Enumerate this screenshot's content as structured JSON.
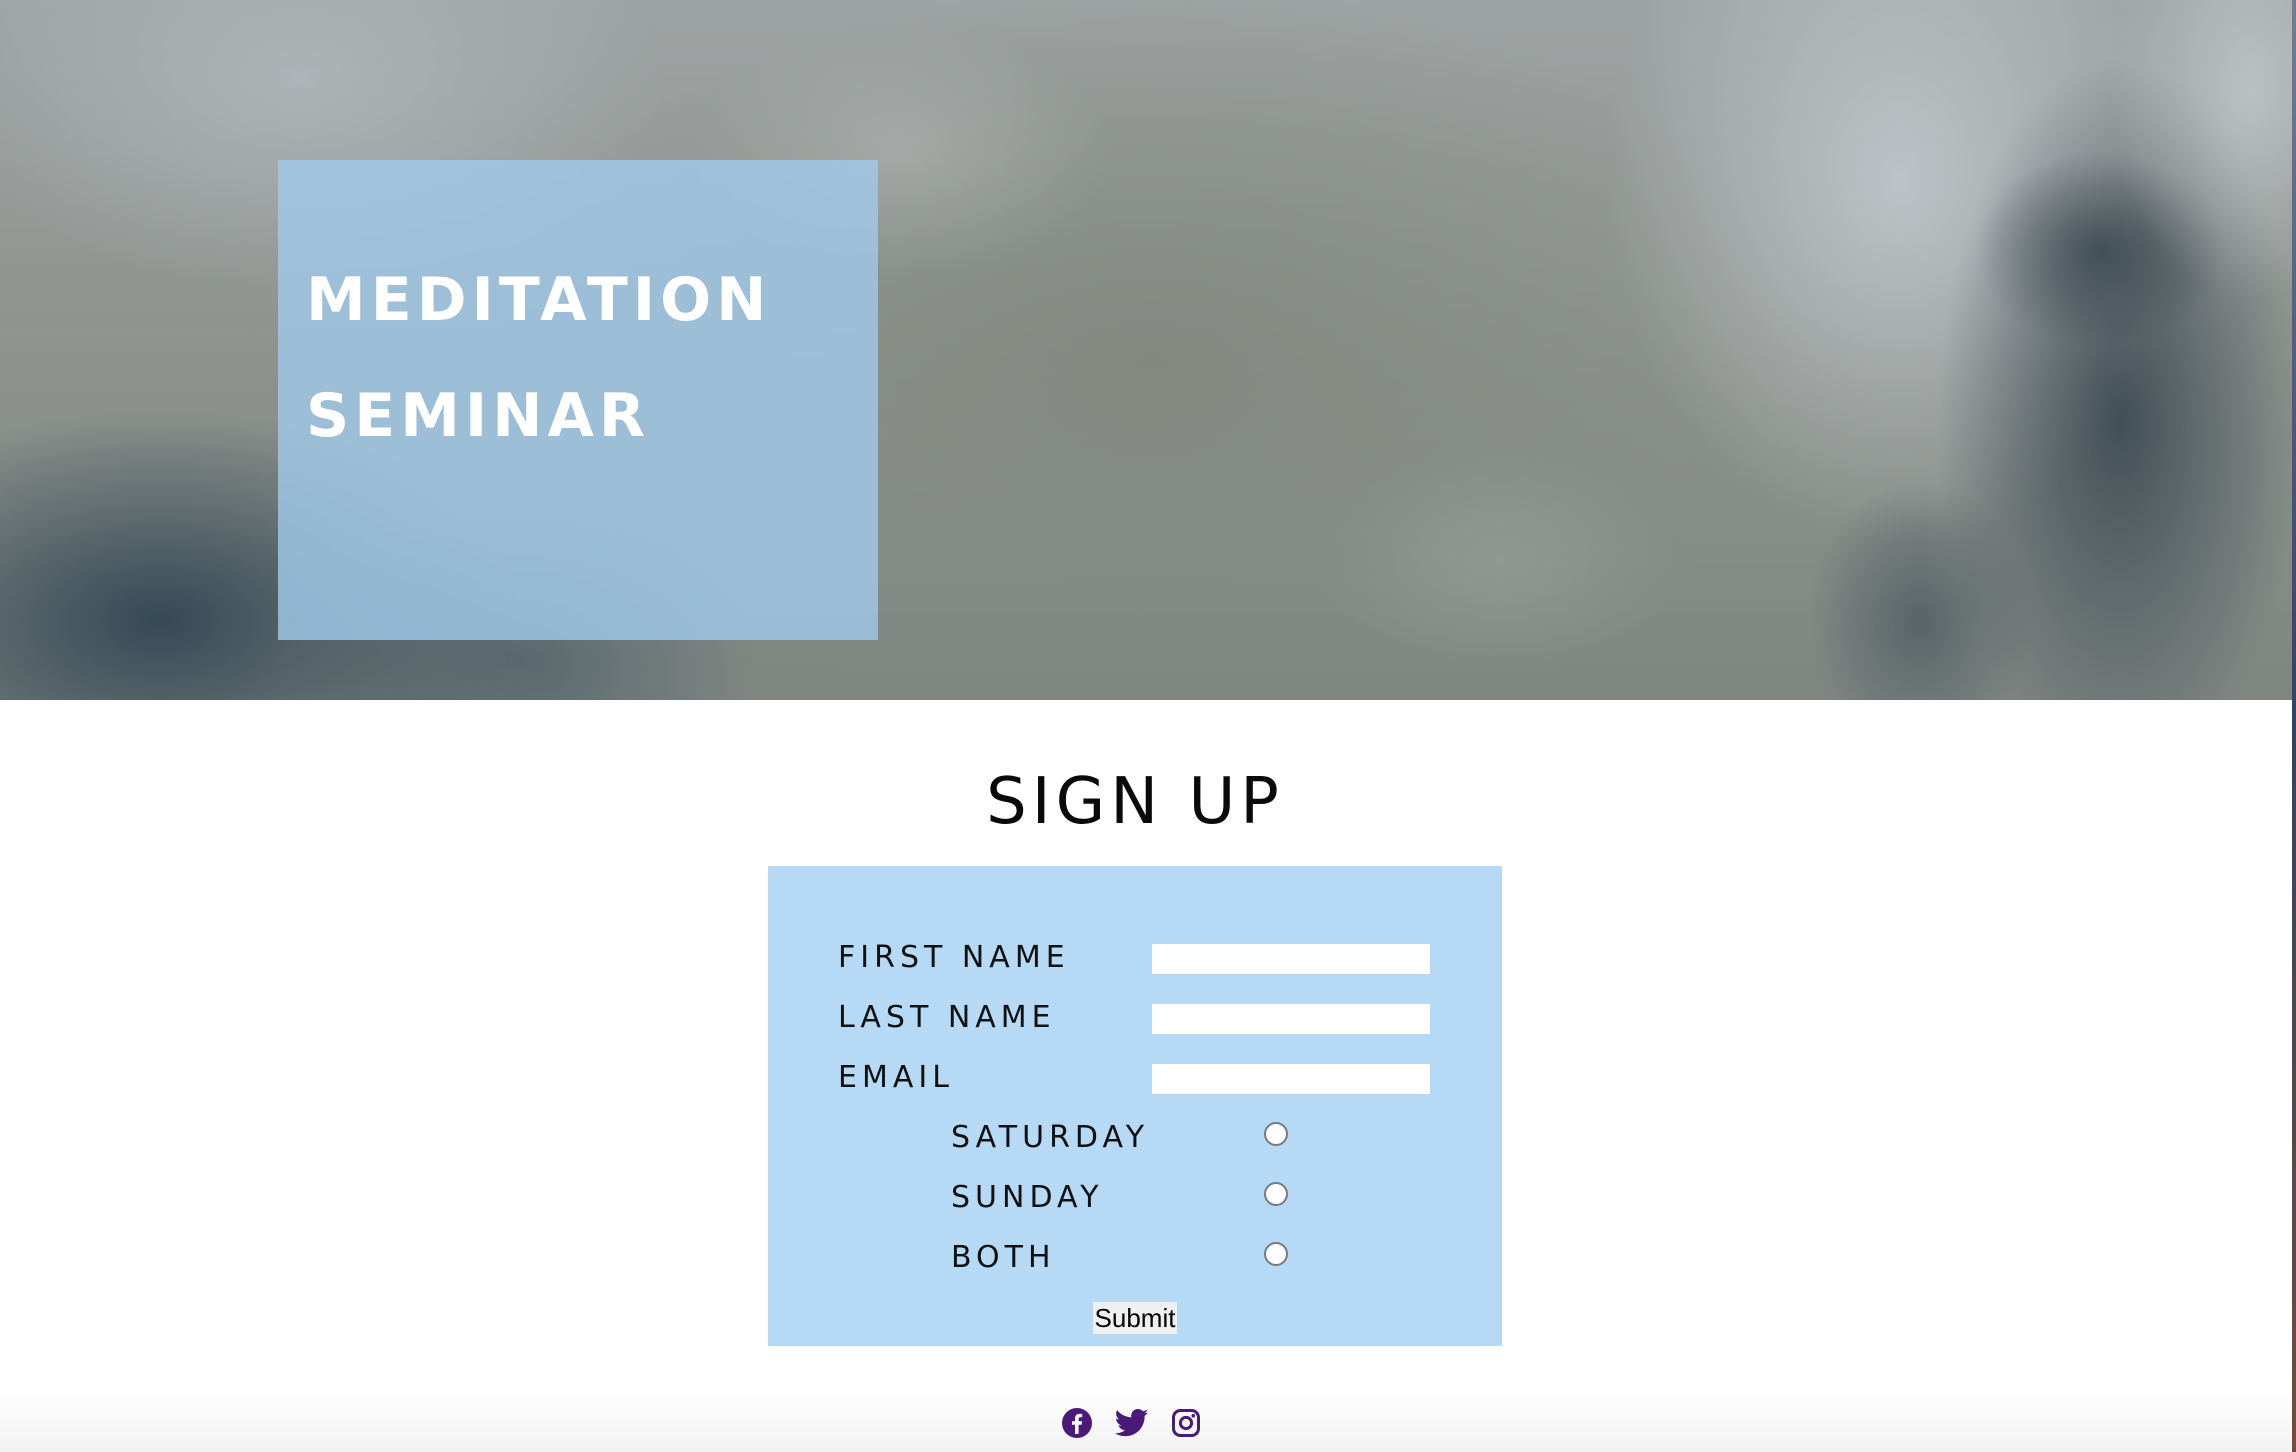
{
  "hero": {
    "title_line1": "MEDITATION",
    "title_line2": "SEMINAR"
  },
  "signup": {
    "heading": "SIGN UP",
    "fields": {
      "first_name_label": "FIRST NAME",
      "first_name_value": "",
      "last_name_label": "LAST NAME",
      "last_name_value": "",
      "email_label": "EMAIL",
      "email_value": ""
    },
    "days": {
      "saturday_label": "SATURDAY",
      "sunday_label": "SUNDAY",
      "both_label": "BOTH"
    },
    "submit_label": "Submit"
  },
  "footer": {
    "social_icons": [
      "facebook-icon",
      "twitter-icon",
      "instagram-icon"
    ]
  },
  "colors": {
    "title_box": "#a0c8e8",
    "form_background": "#b6d9f6",
    "social_icon": "#4a1a7a"
  }
}
